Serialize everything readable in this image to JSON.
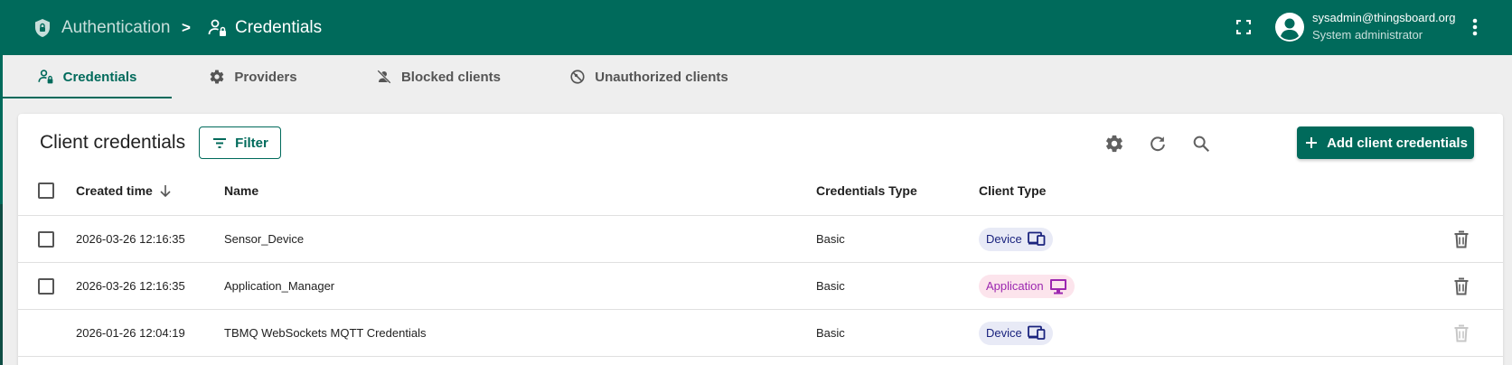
{
  "header": {
    "breadcrumb_root": "Authentication",
    "breadcrumb_sep": ">",
    "breadcrumb_current": "Credentials",
    "user_email": "sysadmin@thingsboard.org",
    "user_role": "System administrator"
  },
  "tabs": [
    {
      "label": "Credentials",
      "icon": "user-lock-icon",
      "active": true
    },
    {
      "label": "Providers",
      "icon": "gear-icon",
      "active": false
    },
    {
      "label": "Blocked clients",
      "icon": "blocked-user-icon",
      "active": false
    },
    {
      "label": "Unauthorized clients",
      "icon": "no-access-icon",
      "active": false
    }
  ],
  "card": {
    "title": "Client credentials",
    "filter_label": "Filter",
    "add_label": "Add client credentials"
  },
  "table": {
    "columns": [
      "Created time",
      "Name",
      "Credentials Type",
      "Client Type"
    ],
    "sort_column": "Created time",
    "sort_direction": "descending",
    "rows": [
      {
        "created": "2026-03-26 12:16:35",
        "name": "Sensor_Device",
        "cred_type": "Basic",
        "client_type": "Device",
        "selectable": true,
        "deletable": true
      },
      {
        "created": "2026-03-26 12:16:35",
        "name": "Application_Manager",
        "cred_type": "Basic",
        "client_type": "Application",
        "selectable": true,
        "deletable": true
      },
      {
        "created": "2026-01-26 12:04:19",
        "name": "TBMQ WebSockets MQTT Credentials",
        "cred_type": "Basic",
        "client_type": "Device",
        "selectable": false,
        "deletable": false
      }
    ]
  },
  "colors": {
    "primary": "#006a5b",
    "device_chip_bg": "#e8eaf6",
    "device_chip_fg": "#1a237e",
    "app_chip_bg": "#fce4ec",
    "app_chip_fg": "#9c27b0"
  }
}
